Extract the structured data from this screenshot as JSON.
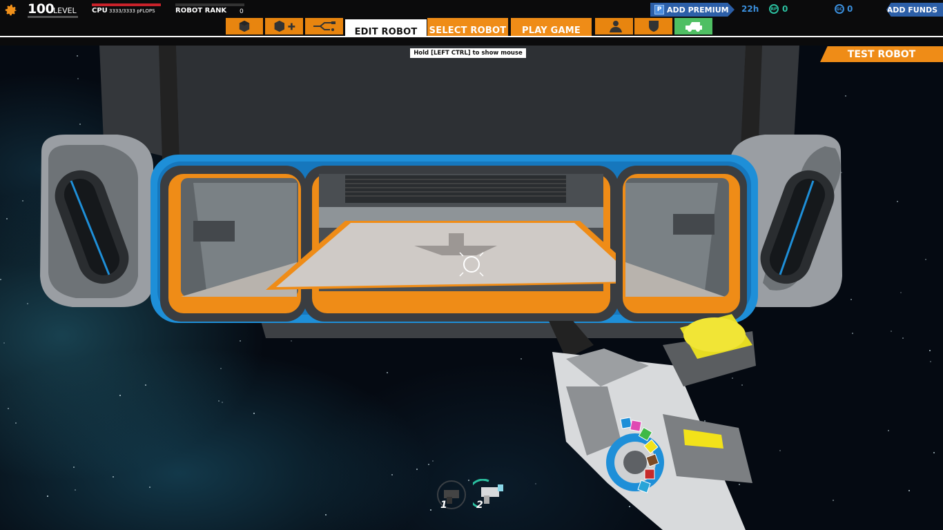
{
  "header": {
    "level_value": "100",
    "level_label": "LEVEL",
    "cpu_label": "CPU",
    "cpu_value": "3333/3333 pFLOPS",
    "cpu_fill": 1.0,
    "rank_label": "ROBOT RANK",
    "rank_value": "0"
  },
  "tabs": {
    "cube_icon": "cube-icon",
    "add_cube_icon": "add-cube-icon",
    "connect_icon": "connect-icon",
    "edit_robot": "EDIT ROBOT",
    "select_robot": "SELECT ROBOT",
    "play_game": "PLAY GAME",
    "profile_icon": "profile-icon",
    "shield_icon": "shield-icon",
    "garage_icon": "garage-icon"
  },
  "currency": {
    "premium_label": "ADD PREMIUM",
    "premium_badge": "P",
    "premium_time": "22h",
    "rp_badge": "RP",
    "rp_value": "0",
    "gc_badge": "GC",
    "gc_value": "0",
    "funds_label": "ADD FUNDS"
  },
  "hint": "Hold [LEFT CTRL] to show mouse",
  "test_robot_button": "TEST ROBOT",
  "weapons": {
    "slot1": "1",
    "slot2": "2"
  },
  "colors": {
    "accent_orange": "#ef8c17",
    "premium_blue": "#2c5fa8",
    "currency_green": "#2bc0a0",
    "cpu_red": "#c8222a",
    "frame_blue": "#1e8fd8"
  }
}
